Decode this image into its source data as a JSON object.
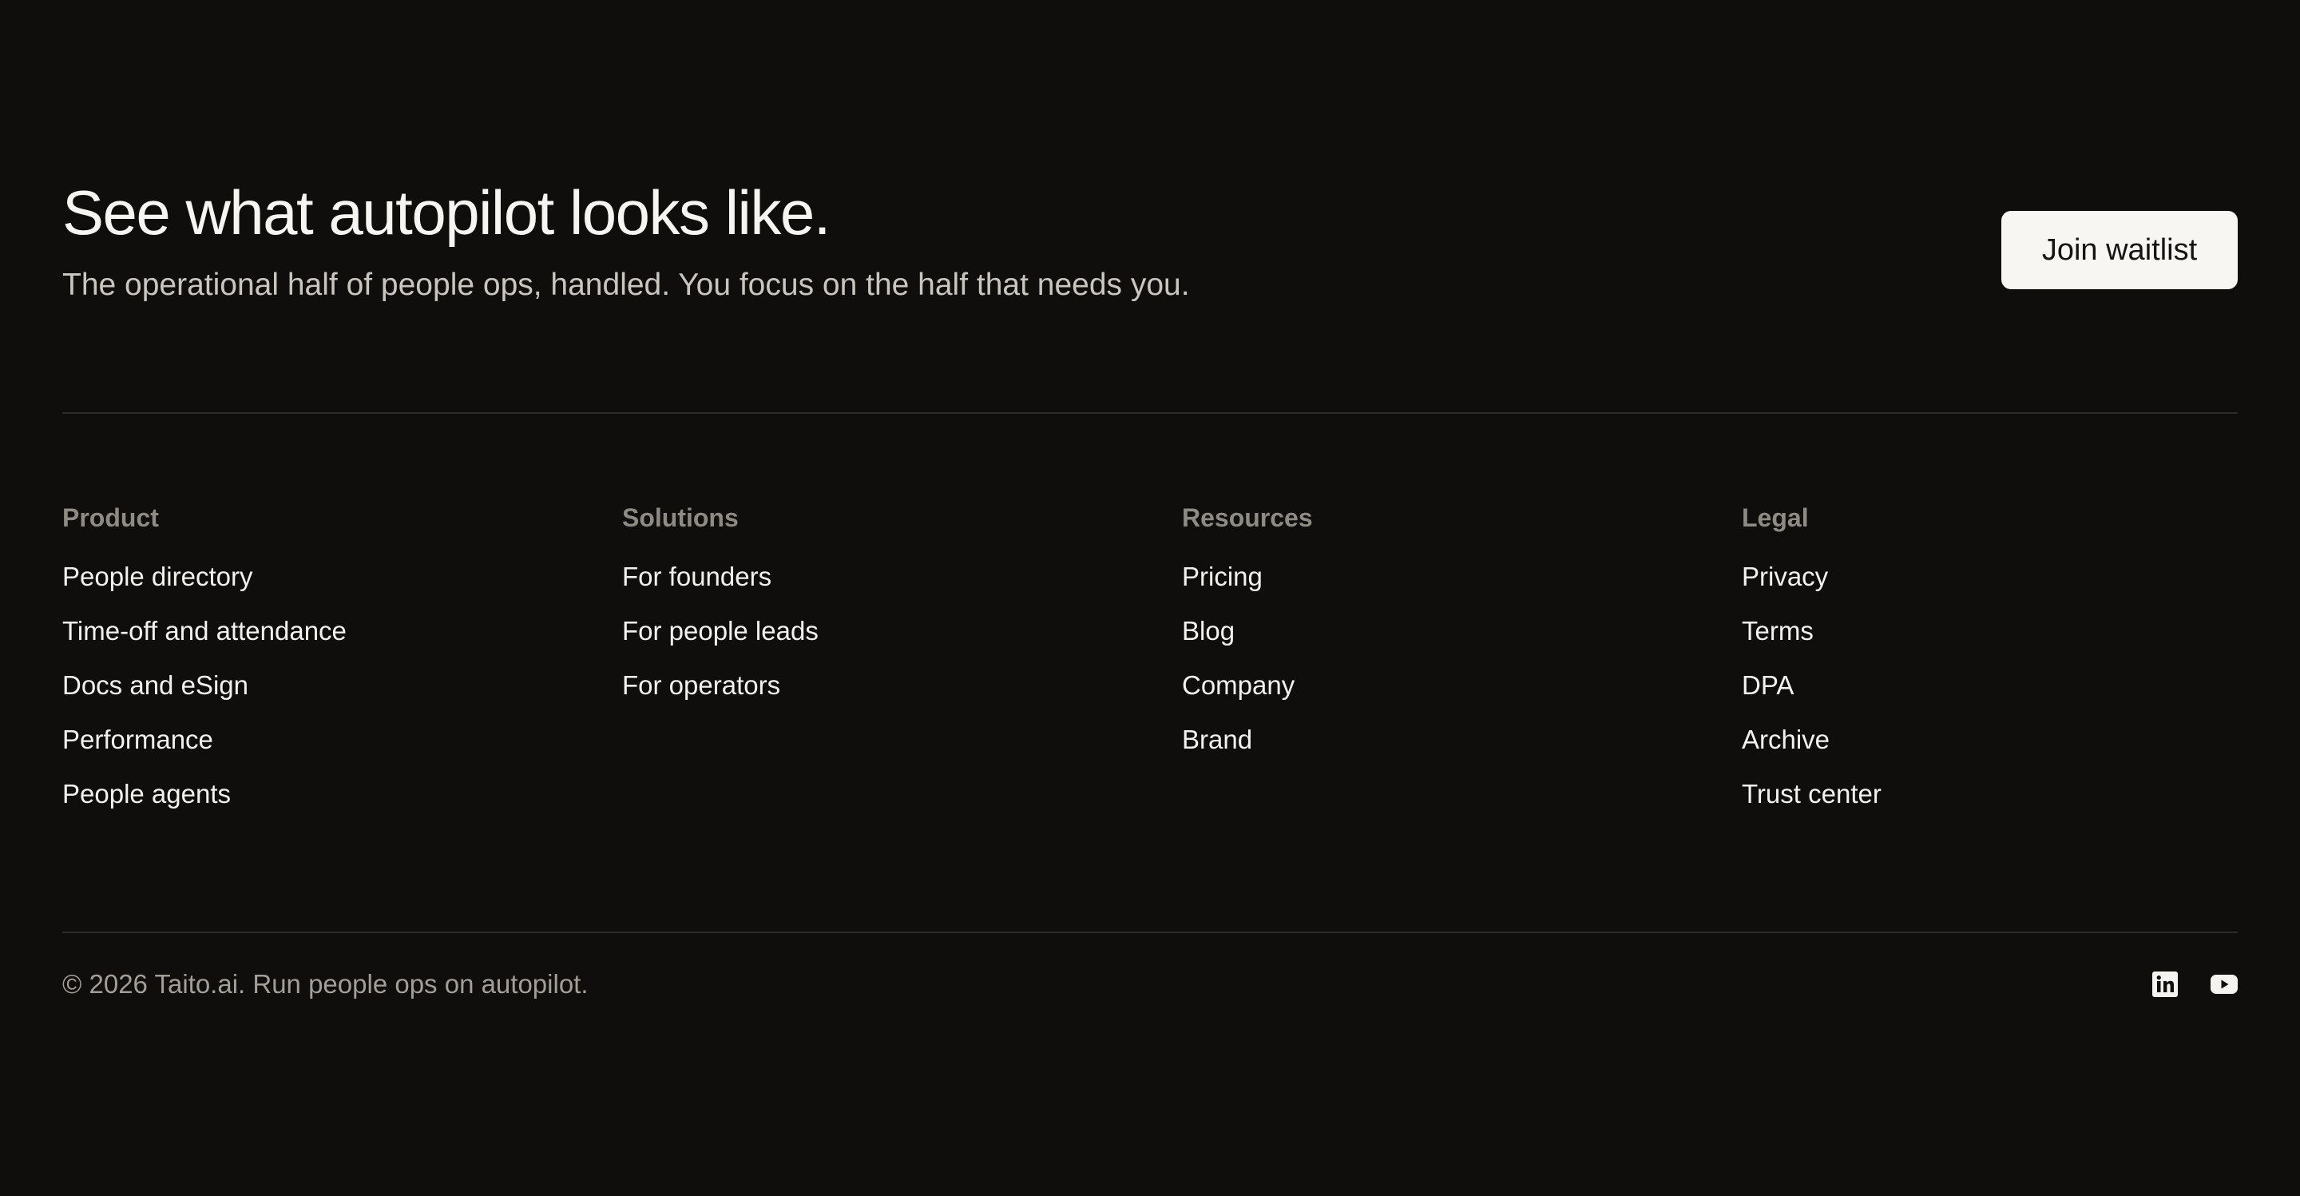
{
  "hero": {
    "title": "See what autopilot looks like.",
    "subtitle": "The operational half of people ops, handled. You focus on the half that needs you.",
    "cta_label": "Join waitlist"
  },
  "columns": [
    {
      "heading": "Product",
      "links": [
        "People directory",
        "Time-off and attendance",
        "Docs and eSign",
        "Performance",
        "People agents"
      ]
    },
    {
      "heading": "Solutions",
      "links": [
        "For founders",
        "For people leads",
        "For operators"
      ]
    },
    {
      "heading": "Resources",
      "links": [
        "Pricing",
        "Blog",
        "Company",
        "Brand"
      ]
    },
    {
      "heading": "Legal",
      "links": [
        "Privacy",
        "Terms",
        "DPA",
        "Archive",
        "Trust center"
      ]
    }
  ],
  "footer": {
    "copyright": "© 2026 Taito.ai. Run people ops on autopilot.",
    "social_icons": [
      "linkedin-icon",
      "youtube-icon"
    ]
  },
  "colors": {
    "background": "#0f0e0d",
    "text": "#f5f3ef",
    "muted": "#8e8a84",
    "button_bg": "#f8f6f2",
    "divider": "#2d2b29"
  }
}
